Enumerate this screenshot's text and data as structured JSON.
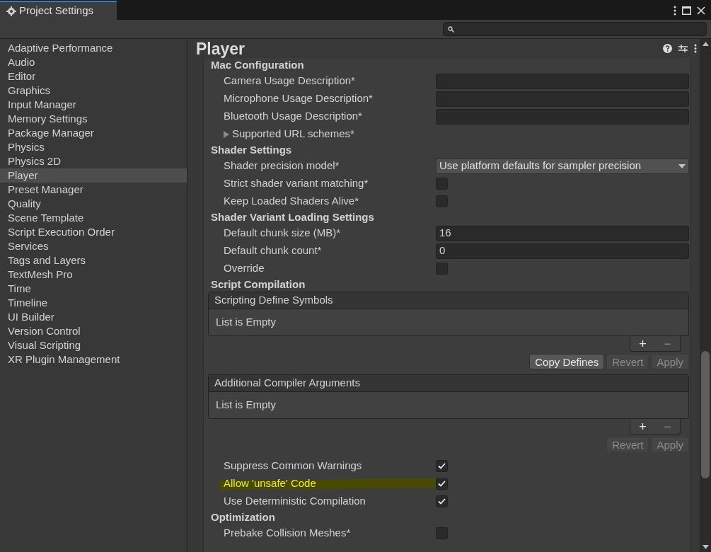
{
  "window": {
    "title": "Project Settings"
  },
  "sidebar": {
    "items": [
      {
        "label": "Adaptive Performance",
        "selected": false
      },
      {
        "label": "Audio",
        "selected": false
      },
      {
        "label": "Editor",
        "selected": false
      },
      {
        "label": "Graphics",
        "selected": false
      },
      {
        "label": "Input Manager",
        "selected": false
      },
      {
        "label": "Memory Settings",
        "selected": false
      },
      {
        "label": "Package Manager",
        "selected": false
      },
      {
        "label": "Physics",
        "selected": false
      },
      {
        "label": "Physics 2D",
        "selected": false
      },
      {
        "label": "Player",
        "selected": true
      },
      {
        "label": "Preset Manager",
        "selected": false
      },
      {
        "label": "Quality",
        "selected": false
      },
      {
        "label": "Scene Template",
        "selected": false
      },
      {
        "label": "Script Execution Order",
        "selected": false
      },
      {
        "label": "Services",
        "selected": false
      },
      {
        "label": "Tags and Layers",
        "selected": false
      },
      {
        "label": "TextMesh Pro",
        "selected": false
      },
      {
        "label": "Time",
        "selected": false
      },
      {
        "label": "Timeline",
        "selected": false
      },
      {
        "label": "UI Builder",
        "selected": false
      },
      {
        "label": "Version Control",
        "selected": false
      },
      {
        "label": "Visual Scripting",
        "selected": false
      },
      {
        "label": "XR Plugin Management",
        "selected": false
      }
    ]
  },
  "panel": {
    "title": "Player",
    "rows": [
      {
        "kind": "heading",
        "label": "Mac Configuration"
      },
      {
        "kind": "field",
        "label": "Camera Usage Description*"
      },
      {
        "kind": "field",
        "label": "Microphone Usage Description*"
      },
      {
        "kind": "field",
        "label": "Bluetooth Usage Description*"
      },
      {
        "kind": "foldout",
        "label": "Supported URL schemes*",
        "expanded": false
      },
      {
        "kind": "heading",
        "label": "Shader Settings"
      },
      {
        "kind": "dropdown",
        "label": "Shader precision model*",
        "value": "Use platform defaults for sampler precision"
      },
      {
        "kind": "checkbox",
        "label": "Strict shader variant matching*",
        "checked": false
      },
      {
        "kind": "checkbox",
        "label": "Keep Loaded Shaders Alive*",
        "checked": false
      },
      {
        "kind": "heading",
        "label": "Shader Variant Loading Settings"
      },
      {
        "kind": "field",
        "label": "Default chunk size (MB)*",
        "value": "16"
      },
      {
        "kind": "field",
        "label": "Default chunk count*",
        "value": "0"
      },
      {
        "kind": "checkbox",
        "label": "Override",
        "checked": false
      },
      {
        "kind": "heading",
        "label": "Script Compilation"
      },
      {
        "kind": "list",
        "label": "Scripting Define Symbols",
        "empty_text": "List is Empty",
        "add": "+",
        "remove": "−"
      },
      {
        "kind": "buttons",
        "buttons": [
          {
            "label": "Copy Defines",
            "disabled": false
          },
          {
            "label": "Revert",
            "disabled": true
          },
          {
            "label": "Apply",
            "disabled": true
          }
        ]
      },
      {
        "kind": "list",
        "label": "Additional Compiler Arguments",
        "empty_text": "List is Empty",
        "add": "+",
        "remove": "−"
      },
      {
        "kind": "buttons",
        "buttons": [
          {
            "label": "Revert",
            "disabled": true
          },
          {
            "label": "Apply",
            "disabled": true
          }
        ]
      },
      {
        "kind": "checkbox",
        "label": "Suppress Common Warnings",
        "checked": true
      },
      {
        "kind": "checkbox",
        "label": "Allow 'unsafe' Code",
        "checked": true,
        "highlighted": true
      },
      {
        "kind": "checkbox",
        "label": "Use Deterministic Compilation",
        "checked": true
      },
      {
        "kind": "heading",
        "label": "Optimization"
      },
      {
        "kind": "checkbox",
        "label": "Prebake Collision Meshes*",
        "checked": false
      }
    ]
  }
}
